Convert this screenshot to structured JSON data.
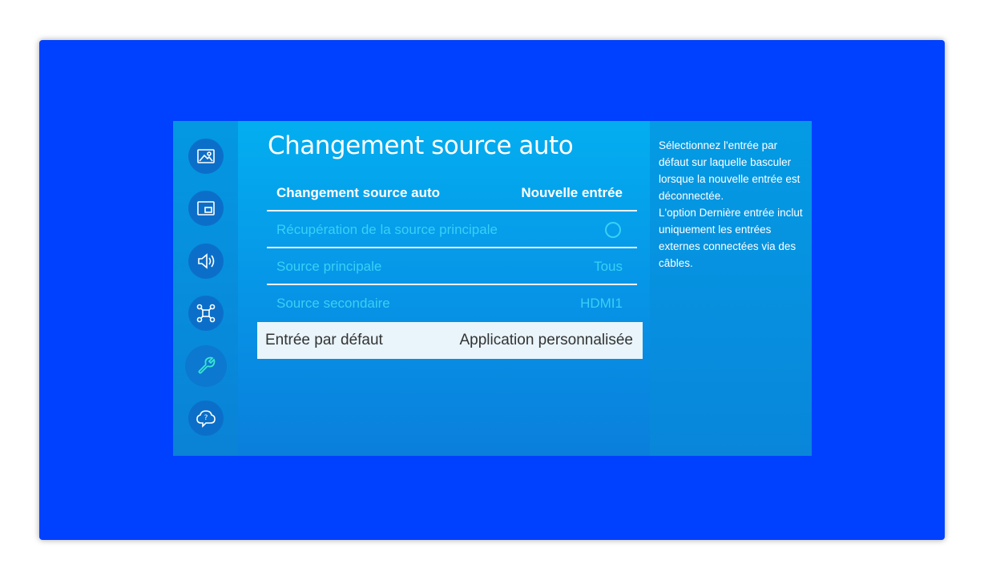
{
  "screen": {
    "title": "Changement source auto",
    "header_row": {
      "label": "Changement source auto",
      "value": "Nouvelle entrée"
    },
    "rows": [
      {
        "label": "Récupération de la source principale",
        "value": ""
      },
      {
        "label": "Source principale",
        "value": "Tous"
      },
      {
        "label": "Source secondaire",
        "value": "HDMI1"
      }
    ],
    "selected_row": {
      "label": "Entrée par défaut",
      "value": "Application personnalisée"
    }
  },
  "info_panel": {
    "text": "Sélectionnez l'entrée par défaut sur laquelle basculer lorsque la nouvelle entrée est déconnectée.\nL'option Dernière entrée inclut uniquement les entrées externes connectées via des câbles."
  },
  "sidebar": {
    "icons": [
      "picture-icon",
      "picture-in-picture-icon",
      "sound-icon",
      "network-icon",
      "wrench-icon",
      "cloud-help-icon"
    ],
    "active": "wrench-icon"
  },
  "colors": {
    "frame": "#0040ff",
    "screen_bg": "#03aef0",
    "dim_text": "#39d0f6",
    "selected_bg": "#e9f5fb"
  }
}
